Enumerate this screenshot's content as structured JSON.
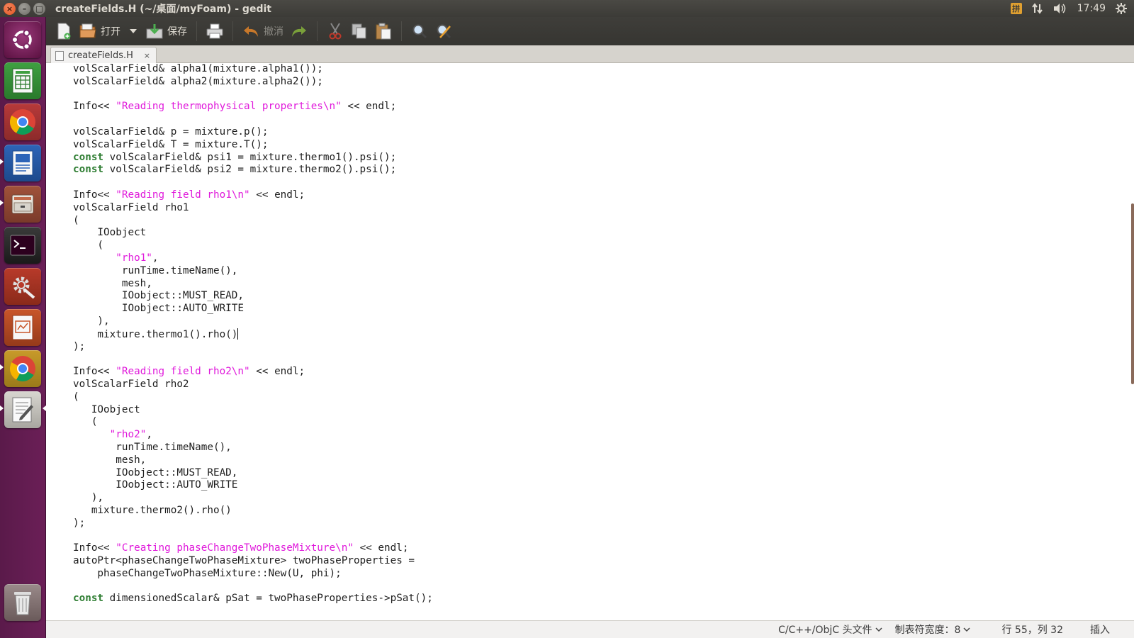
{
  "window": {
    "title": "createFields.H (~/桌面/myFoam) - gedit",
    "close_symbol": "×",
    "minimize_symbol": "–",
    "maximize_symbol": "□"
  },
  "top_panel": {
    "keyboard_indicator": "拼",
    "time": "17:49"
  },
  "toolbar": {
    "open_label": "打开",
    "save_label": "保存",
    "undo_label": "撤消"
  },
  "tab": {
    "label": "createFields.H",
    "close_symbol": "×"
  },
  "editor": {
    "lines": [
      [
        [
          "",
          "volScalarField& alpha1(mixture.alpha1());"
        ]
      ],
      [
        [
          "",
          "volScalarField& alpha2(mixture.alpha2());"
        ]
      ],
      [],
      [
        [
          "",
          "Info<< "
        ],
        [
          "str",
          "\"Reading thermophysical properties\\n\""
        ],
        [
          "",
          " << endl;"
        ]
      ],
      [],
      [
        [
          "",
          "volScalarField& p = mixture.p();"
        ]
      ],
      [
        [
          "",
          "volScalarField& T = mixture.T();"
        ]
      ],
      [
        [
          "kw",
          "const"
        ],
        [
          "",
          " volScalarField& psi1 = mixture.thermo1().psi();"
        ]
      ],
      [
        [
          "kw",
          "const"
        ],
        [
          "",
          " volScalarField& psi2 = mixture.thermo2().psi();"
        ]
      ],
      [],
      [
        [
          "",
          "Info<< "
        ],
        [
          "str",
          "\"Reading field rho1\\n\""
        ],
        [
          "",
          " << endl;"
        ]
      ],
      [
        [
          "",
          "volScalarField rho1"
        ]
      ],
      [
        [
          "",
          "("
        ]
      ],
      [
        [
          "",
          "    IOobject"
        ]
      ],
      [
        [
          "",
          "    ("
        ]
      ],
      [
        [
          "",
          "       "
        ],
        [
          "str",
          "\"rho1\""
        ],
        [
          "",
          ","
        ]
      ],
      [
        [
          "",
          "        runTime.timeName(),"
        ]
      ],
      [
        [
          "",
          "        mesh,"
        ]
      ],
      [
        [
          "",
          "        IOobject::MUST_READ,"
        ]
      ],
      [
        [
          "",
          "        IOobject::AUTO_WRITE"
        ]
      ],
      [
        [
          "",
          "    ),"
        ]
      ],
      [
        [
          "",
          "    mixture.thermo1().rho()"
        ],
        [
          "caret",
          ""
        ]
      ],
      [
        [
          "",
          ");"
        ]
      ],
      [],
      [
        [
          "",
          "Info<< "
        ],
        [
          "str",
          "\"Reading field rho2\\n\""
        ],
        [
          "",
          " << endl;"
        ]
      ],
      [
        [
          "",
          "volScalarField rho2"
        ]
      ],
      [
        [
          "",
          "("
        ]
      ],
      [
        [
          "",
          "   IOobject"
        ]
      ],
      [
        [
          "",
          "   ("
        ]
      ],
      [
        [
          "",
          "      "
        ],
        [
          "str",
          "\"rho2\""
        ],
        [
          "",
          ","
        ]
      ],
      [
        [
          "",
          "       runTime.timeName(),"
        ]
      ],
      [
        [
          "",
          "       mesh,"
        ]
      ],
      [
        [
          "",
          "       IOobject::MUST_READ,"
        ]
      ],
      [
        [
          "",
          "       IOobject::AUTO_WRITE"
        ]
      ],
      [
        [
          "",
          "   ),"
        ]
      ],
      [
        [
          "",
          "   mixture.thermo2().rho()"
        ]
      ],
      [
        [
          "",
          ");"
        ]
      ],
      [],
      [
        [
          "",
          "Info<< "
        ],
        [
          "str",
          "\"Creating phaseChangeTwoPhaseMixture\\n\""
        ],
        [
          "",
          " << endl;"
        ]
      ],
      [
        [
          "",
          "autoPtr<phaseChangeTwoPhaseMixture> twoPhaseProperties ="
        ]
      ],
      [
        [
          "",
          "    phaseChangeTwoPhaseMixture::New(U, phi);"
        ]
      ],
      [],
      [
        [
          "kw",
          "const"
        ],
        [
          "",
          " dimensionedScalar& pSat = twoPhaseProperties->pSat();"
        ]
      ]
    ]
  },
  "statusbar": {
    "language": "C/C++/ObjC 头文件",
    "tab_width": "制表符宽度：8",
    "position": "行 55，列 32",
    "mode": "插入"
  },
  "colors": {
    "string": "#e01adb",
    "keyword": "#2e7d32",
    "launcher": "#6b1f57",
    "panel": "#3c3b37"
  }
}
